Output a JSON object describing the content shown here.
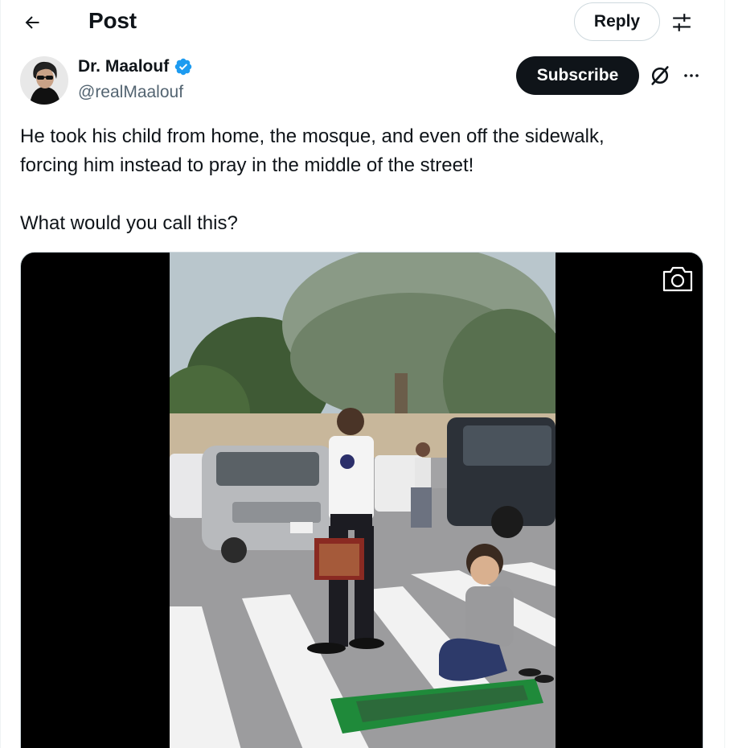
{
  "header": {
    "title": "Post",
    "back_icon": "arrow-left-icon",
    "reply_label": "Reply",
    "tune_icon": "sliders-icon"
  },
  "author": {
    "name": "Dr. Maalouf",
    "handle": "@realMaalouf",
    "verified_icon": "verified-badge-icon",
    "verified_color": "#1d9bf0"
  },
  "actions": {
    "subscribe_label": "Subscribe",
    "grok_icon": "grok-icon",
    "more_icon": "more-horizontal-icon"
  },
  "post": {
    "paragraph_1_line_1": "He took his child from home, the mosque, and even off the sidewalk,",
    "paragraph_1_line_2": "forcing him instead to pray in the middle of the street!",
    "paragraph_2": "What would you call this?"
  },
  "media": {
    "type": "video",
    "overlay_icon": "camera-icon"
  },
  "colors": {
    "text": "#0f1419",
    "secondary_text": "#536471",
    "border": "#cfd9de",
    "button_dark": "#0f1419"
  }
}
